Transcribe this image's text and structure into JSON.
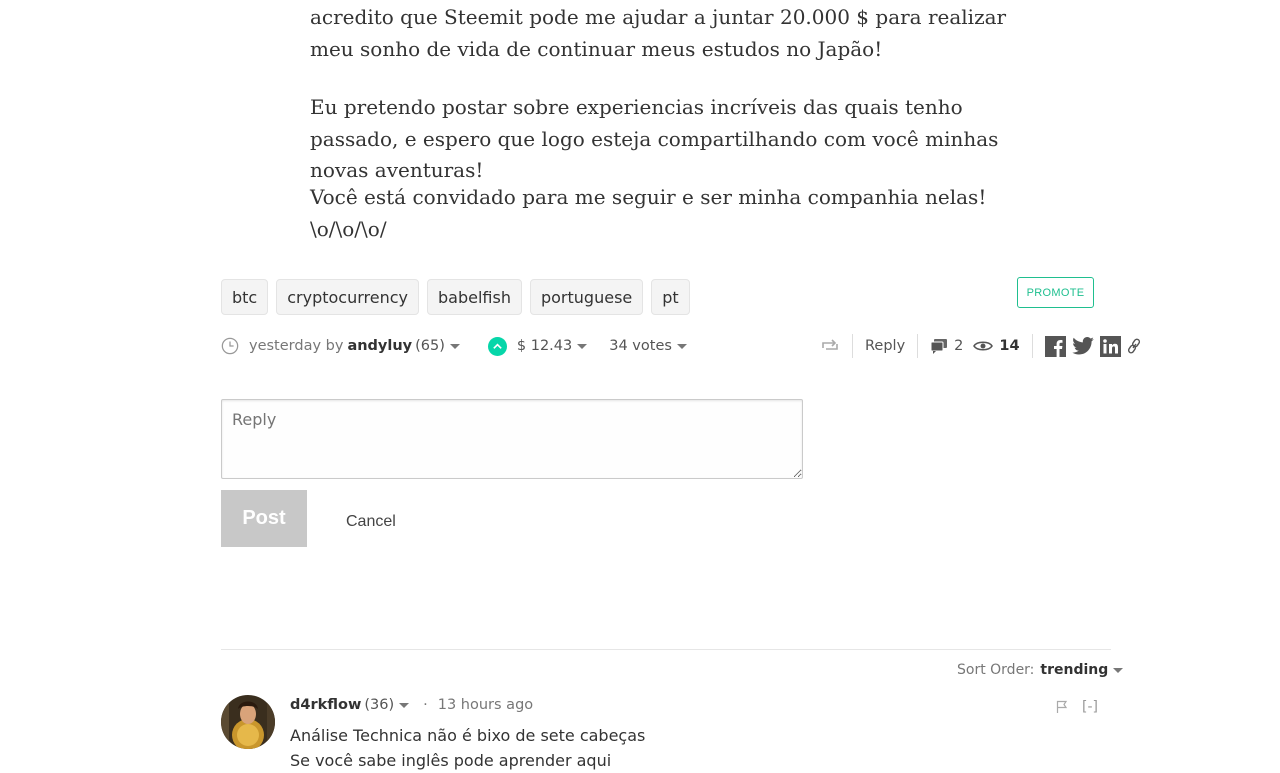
{
  "article": {
    "p1": "acredito que Steemit pode me ajudar a juntar 20.000 $ para realizar meu sonho de vida de continuar meus estudos no Japão!",
    "p2": "Eu pretendo postar sobre experiencias incríveis das quais tenho passado, e espero que logo esteja compartilhando com você minhas novas aventuras!",
    "p3": "Você está convidado para me seguir e ser minha companhia nelas! \\o/\\o/\\o/"
  },
  "tags": [
    "btc",
    "cryptocurrency",
    "babelfish",
    "portuguese",
    "pt"
  ],
  "promote_label": "PROMOTE",
  "meta": {
    "time": "yesterday by",
    "author": "andyluy",
    "reputation": "(65)",
    "payout": "$ 12.43",
    "votes": "34 votes",
    "reply_label": "Reply",
    "comment_count": "2",
    "view_count": "14"
  },
  "reply_form": {
    "placeholder": "Reply",
    "post_label": "Post",
    "cancel_label": "Cancel"
  },
  "sort": {
    "label": "Sort Order:",
    "value": "trending"
  },
  "comment": {
    "author": "d4rkflow",
    "reputation": "(36)",
    "time": "13 hours ago",
    "line1": "Análise Technica não é bixo de sete cabeças",
    "line2": "Se você sabe inglês pode aprender aqui",
    "collapse": "[-]"
  },
  "colors": {
    "accent": "#06d6a9",
    "promote": "#1fbf8f",
    "post_button": "#c8c8c8"
  },
  "icons": [
    "clock-icon",
    "upvote-icon",
    "resteem-icon",
    "comments-icon",
    "eye-icon",
    "facebook-icon",
    "twitter-icon",
    "linkedin-icon",
    "link-icon",
    "flag-icon"
  ]
}
